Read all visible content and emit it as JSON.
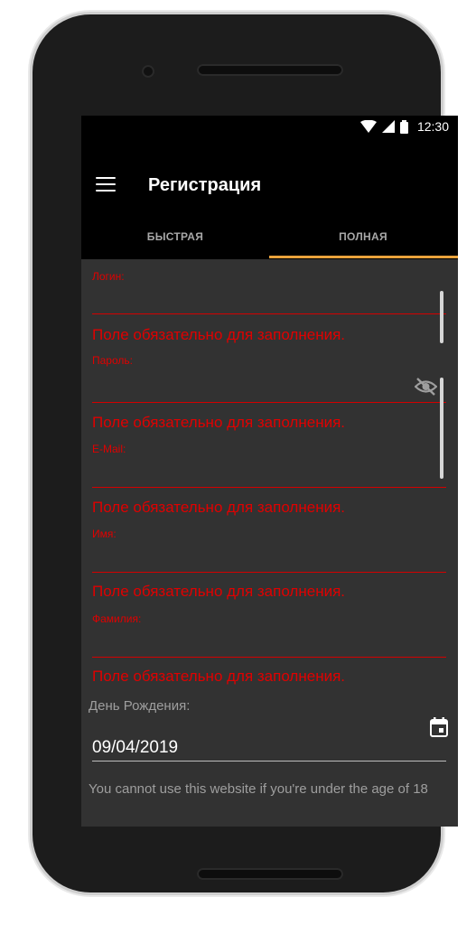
{
  "status_bar": {
    "time": "12:30"
  },
  "app_bar": {
    "title": "Регистрация"
  },
  "tabs": [
    {
      "label": "БЫСТРАЯ",
      "selected": false
    },
    {
      "label": "ПОЛНАЯ",
      "selected": true
    }
  ],
  "accent_color": "#e9a23b",
  "error_color": "#e00000",
  "form": {
    "fields": [
      {
        "label": "Логин:",
        "value": "",
        "error": "Поле обязательно для заполнения."
      },
      {
        "label": "Пароль:",
        "value": "",
        "error": "Поле обязательно для заполнения.",
        "icon": "visibility-off-icon"
      },
      {
        "label": "E-Mail:",
        "value": "",
        "error": "Поле обязательно для заполнения."
      },
      {
        "label": "Имя:",
        "value": "",
        "error": "Поле обязательно для заполнения."
      },
      {
        "label": "Фамилия:",
        "value": "",
        "error": "Поле обязательно для заполнения."
      }
    ],
    "birthday": {
      "label": "День Рождения:",
      "value": "09/04/2019",
      "icon": "calendar-icon"
    },
    "age_note": "You cannot use this website if you're under the age of 18"
  }
}
